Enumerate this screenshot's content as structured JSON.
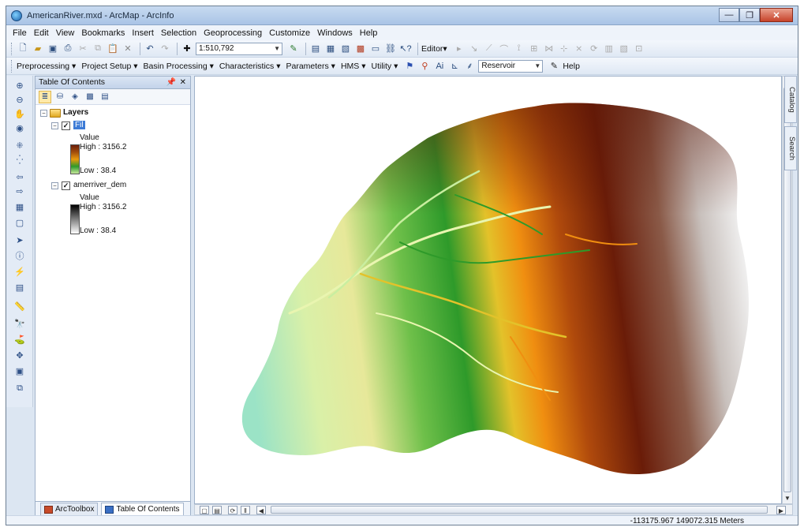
{
  "window": {
    "title": "AmericanRiver.mxd - ArcMap - ArcInfo",
    "minimize_icon": "minimize-icon",
    "maximize_icon": "maximize-icon",
    "close_icon": "close-icon"
  },
  "menu": [
    "File",
    "Edit",
    "View",
    "Bookmarks",
    "Insert",
    "Selection",
    "Geoprocessing",
    "Customize",
    "Windows",
    "Help"
  ],
  "standard_toolbar": {
    "scale": "1:510,792",
    "editor_label": "Editor▾"
  },
  "hms_toolbar": {
    "items": [
      "Preprocessing ▾",
      "Project Setup ▾",
      "Basin Processing ▾",
      "Characteristics ▾",
      "Parameters ▾",
      "HMS ▾",
      "Utility ▾"
    ],
    "layer_combo": "Reservoir",
    "help_label": "Help"
  },
  "toc": {
    "title": "Table Of Contents",
    "root_label": "Layers",
    "layers": [
      {
        "name": "Fil",
        "checked": true,
        "value_label": "Value",
        "high": "High : 3156.2",
        "low": "Low : 38.4"
      },
      {
        "name": "amerriver_dem",
        "checked": true,
        "value_label": "Value",
        "high": "High : 3156.2",
        "low": "Low : 38.4"
      }
    ],
    "tabs": [
      "ArcToolbox",
      "Table Of Contents"
    ],
    "active_tab": "Table Of Contents"
  },
  "right_dock": [
    "Catalog",
    "Search"
  ],
  "status": {
    "coordinates": "-113175.967  149072.315 Meters"
  },
  "colors": {
    "elevation_high": "#5c1606",
    "elevation_mid": "#e8860a",
    "elevation_low_green": "#2e9a2a",
    "elevation_lowest": "#9be3c6",
    "snow": "#f2f2f2"
  }
}
